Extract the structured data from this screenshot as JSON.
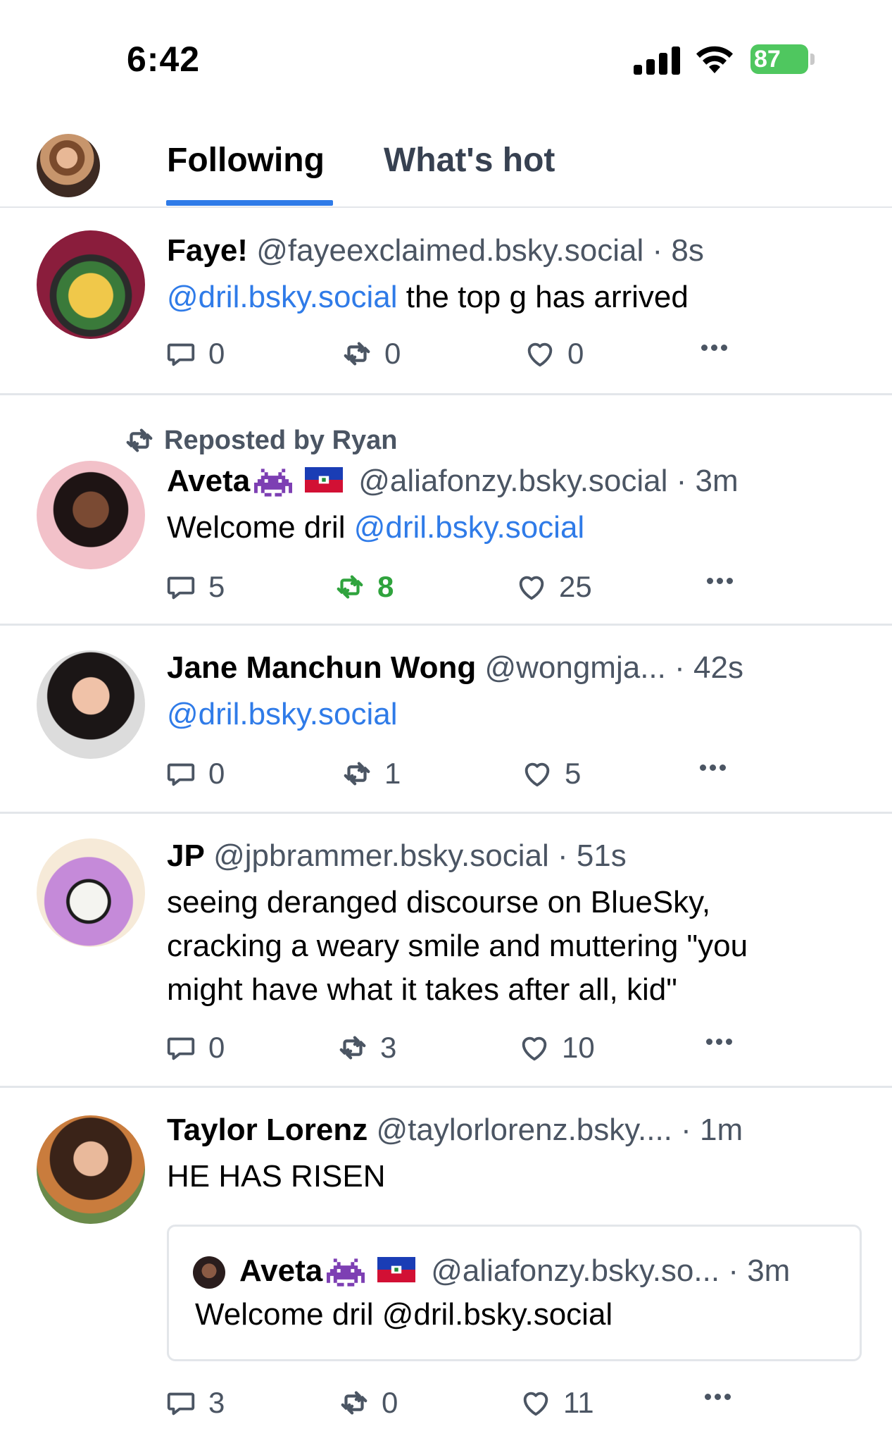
{
  "status_bar": {
    "time": "6:42",
    "battery": "87"
  },
  "header": {
    "tabs": [
      {
        "label": "Following",
        "active": true
      },
      {
        "label": "What's hot",
        "active": false
      }
    ]
  },
  "colors": {
    "accent": "#2f7be8",
    "repost_active": "#2fa33d",
    "muted": "#4b5563",
    "divider": "#e3e6ea"
  },
  "icons": {
    "reply": "speech-bubble-icon",
    "repost": "repost-arrows-icon",
    "like": "heart-icon",
    "more": "ellipsis-icon",
    "alien": "space-invader-emoji",
    "flag": "haiti-flag-emoji"
  },
  "posts": [
    {
      "name": "Faye!",
      "handle": "@fayeexclaimed.bsky.social",
      "time": "· 8s",
      "text_mention": "@dril.bsky.social",
      "text_rest": " the top g has arrived",
      "replies": "0",
      "reposts": "0",
      "likes": "0"
    },
    {
      "reposted_by": "Reposted by Ryan",
      "name": "Aveta",
      "handle": "@aliafonzy.bsky.social",
      "time": "· 3m",
      "text_rest": "Welcome dril ",
      "text_mention": "@dril.bsky.social",
      "replies": "5",
      "reposts": "8",
      "likes": "25",
      "reposted_by_viewer": true
    },
    {
      "name": "Jane Manchun Wong",
      "handle": "@wongmja...",
      "time": "· 42s",
      "text_mention": "@dril.bsky.social",
      "replies": "0",
      "reposts": "1",
      "likes": "5"
    },
    {
      "name": "JP",
      "handle": "@jpbrammer.bsky.social",
      "time": "· 51s",
      "text_lines": [
        "seeing deranged discourse on BlueSky,",
        "cracking a weary smile and muttering \"you",
        "might have what it takes after all, kid\""
      ],
      "replies": "0",
      "reposts": "3",
      "likes": "10"
    },
    {
      "name": "Taylor Lorenz",
      "handle": "@taylorlorenz.bsky....",
      "time": "· 1m",
      "text": "HE HAS RISEN",
      "quote": {
        "name": "Aveta",
        "handle": "@aliafonzy.bsky.so...",
        "time": "· 3m",
        "text": "Welcome dril @dril.bsky.social"
      },
      "replies": "3",
      "reposts": "0",
      "likes": "11"
    }
  ]
}
